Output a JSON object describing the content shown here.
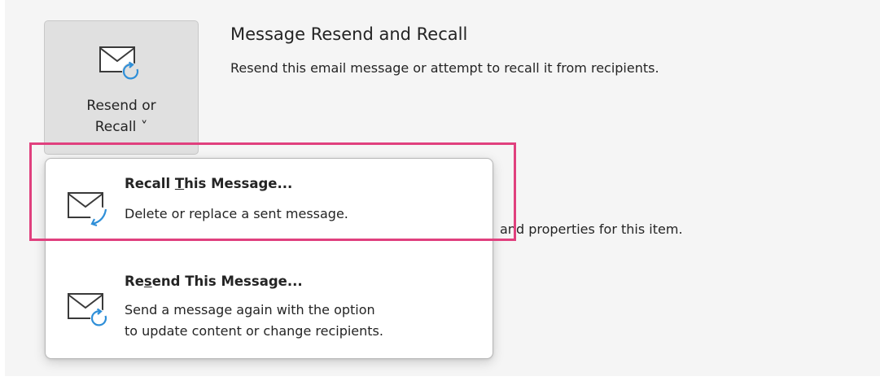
{
  "button": {
    "label_line1": "Resend or",
    "label_line2": "Recall",
    "chevron": "˅",
    "icon": "envelope-refresh-icon"
  },
  "section": {
    "title": "Message Resend and Recall",
    "description": "Resend this email message or attempt to recall it from recipients."
  },
  "background": {
    "partial_text": "and properties for this item."
  },
  "menu": {
    "items": [
      {
        "title_before": "Recall ",
        "mnemonic": "T",
        "title_after": "his Message...",
        "description": [
          "Delete or replace a sent message."
        ],
        "icon": "envelope-recall-icon"
      },
      {
        "title_before": "Re",
        "mnemonic": "s",
        "title_after": "end This Message...",
        "description": [
          "Send a message again with the option",
          "to update content or change recipients."
        ],
        "icon": "envelope-resend-icon"
      }
    ]
  },
  "colors": {
    "accent_blue": "#2f8fd8",
    "highlight": "#e0407e",
    "panel_bg": "#f5f5f5"
  }
}
